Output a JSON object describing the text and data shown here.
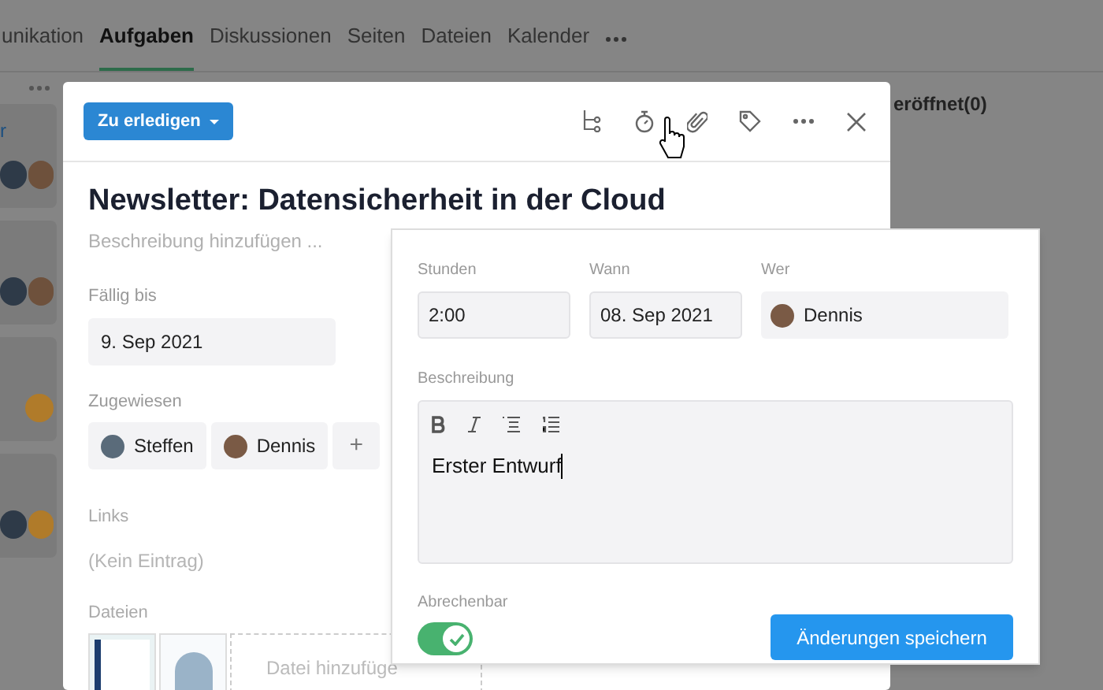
{
  "nav": {
    "tabs": [
      {
        "label": "unikation",
        "selected": false
      },
      {
        "label": "Aufgaben",
        "selected": true
      },
      {
        "label": "Diskussionen",
        "selected": false
      },
      {
        "label": "Seiten",
        "selected": false
      },
      {
        "label": "Dateien",
        "selected": false
      },
      {
        "label": "Kalender",
        "selected": false
      }
    ]
  },
  "background": {
    "left_link": "r",
    "right_heading": "eröffnet(0)"
  },
  "task": {
    "status": "Zu erledigen",
    "title": "Newsletter: Datensicherheit in der Cloud",
    "description_placeholder": "Beschreibung hinzufügen ...",
    "due": {
      "label": "Fällig bis",
      "value": "9. Sep 2021"
    },
    "assigned": {
      "label": "Zugewiesen",
      "people": [
        {
          "name": "Steffen"
        },
        {
          "name": "Dennis"
        }
      ],
      "add": "+"
    },
    "links": {
      "label": "Links",
      "value": "(Kein Eintrag)"
    },
    "files": {
      "label": "Dateien",
      "add": "Datei hinzufüge"
    }
  },
  "time_entry": {
    "hours": {
      "label": "Stunden",
      "value": "2:00"
    },
    "when": {
      "label": "Wann",
      "value": "08. Sep 2021"
    },
    "who": {
      "label": "Wer",
      "value": "Dennis"
    },
    "description": {
      "label": "Beschreibung",
      "value": "Erster Entwurf"
    },
    "billable": {
      "label": "Abrechenbar",
      "on": true
    },
    "save": "Änderungen speichern"
  }
}
